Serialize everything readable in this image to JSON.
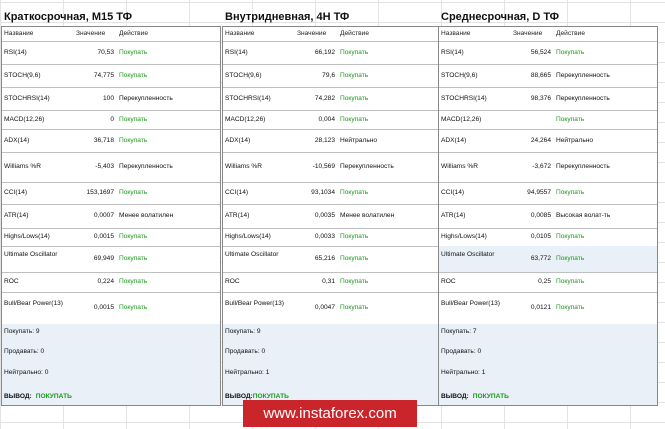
{
  "colors": {
    "buy": "#1a9a1a",
    "highlight": "#e9f0f8",
    "watermark_bg": "#c9252b"
  },
  "header": {
    "name": "Название",
    "value": "Значение",
    "action": "Действие"
  },
  "panels": [
    {
      "title": "Краткосрочная, M15 ТФ",
      "rows": [
        {
          "name": "RSI(14)",
          "value": "70,53",
          "action": "Покупать",
          "buy": true
        },
        {
          "name": "STOCH(9,6)",
          "value": "74,775",
          "action": "Покупать",
          "buy": true
        },
        {
          "name": "STOCHRSI(14)",
          "value": "100",
          "action": "Перекупленность",
          "buy": false
        },
        {
          "name": "MACD(12,26)",
          "value": "0",
          "action": "Покупать",
          "buy": true
        },
        {
          "name": "ADX(14)",
          "value": "36,718",
          "action": "Покупать",
          "buy": true
        },
        {
          "name": "Williams %R",
          "value": "-5,403",
          "action": "Перекупленность",
          "buy": false
        },
        {
          "name": "CCI(14)",
          "value": "153,1697",
          "action": "Покупать",
          "buy": true
        },
        {
          "name": "ATR(14)",
          "value": "0,0007",
          "action": "Менее волатилен",
          "buy": false
        },
        {
          "name": "Highs/Lows(14)",
          "value": "0,0015",
          "action": "Покупать",
          "buy": true
        },
        {
          "name": "Ultimate Oscillator",
          "value": "69,949",
          "action": "Покупать",
          "buy": true
        },
        {
          "name": "ROC",
          "value": "0,224",
          "action": "Покупать",
          "buy": true
        },
        {
          "name": "Bull/Bear Power(13)",
          "value": "0,0015",
          "action": "Покупать",
          "buy": true
        }
      ],
      "summary": {
        "buy": "Покупать: 9",
        "sell": "Продавать: 0",
        "neutral": "Нейтрально: 0",
        "verdict_label": "ВЫВОД:",
        "verdict": "ПОКУПАТЬ"
      }
    },
    {
      "title": "Внутридневная, 4H ТФ",
      "rows": [
        {
          "name": "RSI(14)",
          "value": "66,192",
          "action": "Покупать",
          "buy": true
        },
        {
          "name": "STOCH(9,6)",
          "value": "79,6",
          "action": "Покупать",
          "buy": true
        },
        {
          "name": "STOCHRSI(14)",
          "value": "74,282",
          "action": "Покупать",
          "buy": true
        },
        {
          "name": "MACD(12,26)",
          "value": "0,004",
          "action": "Покупать",
          "buy": true
        },
        {
          "name": "ADX(14)",
          "value": "28,123",
          "action": "Нейтрально",
          "buy": false
        },
        {
          "name": "Williams %R",
          "value": "-10,569",
          "action": "Перекупленность",
          "buy": false
        },
        {
          "name": "CCI(14)",
          "value": "93,1034",
          "action": "Покупать",
          "buy": true
        },
        {
          "name": "ATR(14)",
          "value": "0,0035",
          "action": "Менее волатилен",
          "buy": false
        },
        {
          "name": "Highs/Lows(14)",
          "value": "0,0033",
          "action": "Покупать",
          "buy": true
        },
        {
          "name": "Ultimate Oscillator",
          "value": "65,216",
          "action": "Покупать",
          "buy": true
        },
        {
          "name": "ROC",
          "value": "0,31",
          "action": "Покупать",
          "buy": true
        },
        {
          "name": "Bull/Bear Power(13)",
          "value": "0,0047",
          "action": "Покупать",
          "buy": true
        }
      ],
      "summary": {
        "buy": "Покупать: 9",
        "sell": "Продавать: 0",
        "neutral": "Нейтрально: 1",
        "verdict_label": "ВЫВОД:",
        "verdict": "ПОКУПАТЬ"
      }
    },
    {
      "title": "Среднесрочная, D ТФ",
      "rows": [
        {
          "name": "RSI(14)",
          "value": "56,524",
          "action": "Покупать",
          "buy": true
        },
        {
          "name": "STOCH(9,6)",
          "value": "88,665",
          "action": "Перекупленность",
          "buy": false
        },
        {
          "name": "STOCHRSI(14)",
          "value": "98,376",
          "action": "Перекупленность",
          "buy": false
        },
        {
          "name": "MACD(12,26)",
          "value": "",
          "action": "Покупать",
          "buy": true
        },
        {
          "name": "ADX(14)",
          "value": "24,264",
          "action": "Нейтрально",
          "buy": false
        },
        {
          "name": "Williams %R",
          "value": "-3,672",
          "action": "Перекупленность",
          "buy": false
        },
        {
          "name": "CCI(14)",
          "value": "94,9557",
          "action": "Покупать",
          "buy": true
        },
        {
          "name": "ATR(14)",
          "value": "0,0085",
          "action": "Высокая волат-ть",
          "buy": false
        },
        {
          "name": "Highs/Lows(14)",
          "value": "0,0105",
          "action": "Покупать",
          "buy": true
        },
        {
          "name": "Ultimate Oscillator",
          "value": "63,772",
          "action": "Покупать",
          "buy": true
        },
        {
          "name": "ROC",
          "value": "0,25",
          "action": "Покупать",
          "buy": true
        },
        {
          "name": "Bull/Bear Power(13)",
          "value": "0,0121",
          "action": "Покупать",
          "buy": true
        }
      ],
      "summary": {
        "buy": "Покупать: 7",
        "sell": "Продавать: 0",
        "neutral": "Нейтрально: 1",
        "verdict_label": "ВЫВОД:",
        "verdict": "ПОКУПАТЬ"
      }
    }
  ],
  "watermark": "www.instaforex.com"
}
